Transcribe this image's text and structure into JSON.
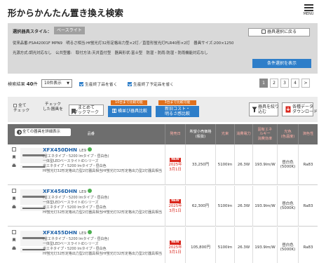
{
  "header": {
    "title": "形からかんたん置き換え検索",
    "menu_label": "MENU"
  },
  "conditions": {
    "label": "選択器具スタイル：",
    "style_badge": "ベースライト",
    "back_button": "器具選択に戻る",
    "line1": "従来品番:FSA42001F MPN9　明るさ相当:Hf蛍光灯32形定格出力型×2灯／直管形蛍光灯FLR40形×2灯　器具サイズ:200×1250",
    "line2": "光源方式:調光対応なし　公共型番:　取付方法:天井直付型　器具形状:富士型　防湿・防雨:防湿・防雨機能対応なし",
    "show_button": "条件選択を表示"
  },
  "results": {
    "label": "検索結果",
    "count": "40",
    "unit": "件",
    "per_page": "10件表示",
    "option1": "生産終了品を省く",
    "option2": "生産終了予定品を省く",
    "pages": [
      "1",
      "2",
      "3",
      "4",
      ">"
    ]
  },
  "toolbar": {
    "check_line1": "全て",
    "check_line2": "チェック",
    "hint_line1": "チェック",
    "hint_line2": "した器具を",
    "bookmark_line1": "まとめて",
    "bookmark_line2": "ブックマーク",
    "tag1": "10台まで比較可能",
    "compare1": "横並び器具比較",
    "tag2": "3台まで比較可能",
    "compare2_line1": "新旧コスト・",
    "compare2_line2": "明るさ感比較",
    "narrow_line1": "器具を絞り",
    "narrow_line2": "込む",
    "dl_line1": "各種データ",
    "dl_line2": "ダウンロード"
  },
  "table": {
    "detail_button": "全ての器具を詳細表示",
    "headers": {
      "product": "品番",
      "release": "発売日",
      "price_l1": "希望小売価格",
      "price_l2": "(税抜)",
      "flux": "光束",
      "power": "消費電力",
      "efficiency_l1": "固有エネ",
      "efficiency_l2": "ルギー",
      "efficiency_l3": "消費効率",
      "color_l1": "光色",
      "color_l2": "(色温度)",
      "cri": "演色性"
    },
    "rows": [
      {
        "model": "XFX450DHN",
        "suffix": "LE9",
        "d1": "(省エネタイプ・5200 lmタイプ・昼白色)",
        "d2": "一体型LEDベースライトiDシリーズ",
        "d3": "省エネタイプ・5200 lmタイプ・昼白色",
        "d4": "Hf蛍光灯32形定格出力型2灯器具相当Hf蛍光灯32形定格出力型2灯器具相当",
        "new_label": "NEW",
        "release_l1": "2025年",
        "release_l2": "3月1日",
        "price": "33,250円",
        "flux": "5100lm",
        "power": "26.3W",
        "efficiency": "193.9lm/W",
        "color_l1": "昼白色",
        "color_l2": "(5000K)",
        "cri": "Ra83"
      },
      {
        "model": "XFX456DHN",
        "suffix": "LE9",
        "d1": "(省エネタイプ・5200 lmタイプ・昼白色)",
        "d2": "一体型LEDベースライトiDシリーズ",
        "d3": "省エネタイプ・5200 lmタイプ・昼白色",
        "d4": "Hf蛍光灯32形定格出力型2灯器具相当Hf蛍光灯32形定格出力型2灯器具相当",
        "new_label": "NEW",
        "release_l1": "2025年",
        "release_l2": "3月1日",
        "price": "62,300円",
        "flux": "5100lm",
        "power": "26.3W",
        "efficiency": "193.9lm/W",
        "color_l1": "昼白色",
        "color_l2": "(5000K)",
        "cri": "Ra83"
      },
      {
        "model": "XFX455DHN",
        "suffix": "LE9",
        "d1": "(省エネタイプ・5200 lmタイプ・昼白色)",
        "d2": "一体型LEDベースライトiDシリーズ",
        "d3": "省エネタイプ・5200 lmタイプ・昼白色",
        "d4": "Hf蛍光灯32形定格出力型2灯器具相当Hf蛍光灯32形定格出力型2灯器具相当",
        "new_label": "NEW",
        "release_l1": "2025年",
        "release_l2": "3月1日",
        "price": "105,800円",
        "flux": "5100lm",
        "power": "26.3W",
        "efficiency": "193.9lm/W",
        "color_l1": "昼白色",
        "color_l2": "(5000K)",
        "cri": "Ra83"
      }
    ]
  },
  "colors": {
    "accent": "#2e7ec9",
    "new_badge": "#d9261c",
    "tag_orange": "#e0701c",
    "model_link": "#1a5fa8"
  }
}
